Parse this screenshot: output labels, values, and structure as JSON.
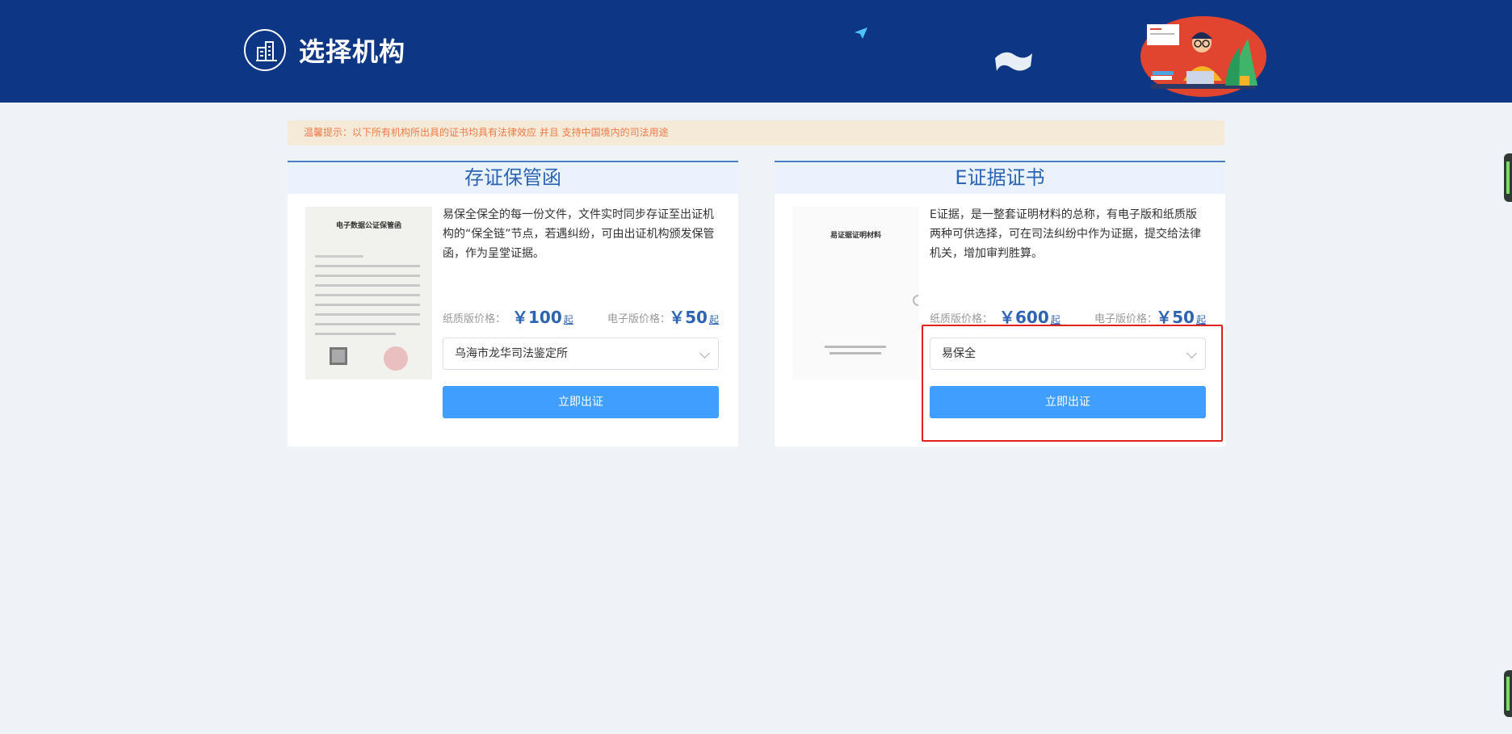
{
  "header": {
    "title": "选择机构",
    "logo_icon": "building-icon",
    "bg_color": "#0d3784"
  },
  "notice": {
    "text": "温馨提示：以下所有机构所出具的证书均具有法律效应 并且 支持中国境内的司法用途"
  },
  "cards": [
    {
      "title": "存证保管函",
      "doc_title": "电子数据公证保管函",
      "description": "易保全保全的每一份文件，文件实时同步存证至出证机构的“保全链”节点，若遇纠纷，可由出证机构颁发保管函，作为呈堂证据。",
      "paper_price_label": "纸质版价格：",
      "paper_price": "￥100",
      "paper_price_suffix": "起",
      "e_price_label": "电子版价格：",
      "e_price": "￥50",
      "e_price_suffix": "起",
      "select_value": "乌海市龙华司法鉴定所",
      "button_label": "立即出证"
    },
    {
      "title": "E证据证书",
      "doc_title": "易证据证明材料",
      "description": "E证据，是一整套证明材料的总称，有电子版和纸质版两种可供选择，可在司法纠纷中作为证据，提交给法律机关，增加审判胜算。",
      "paper_price_label": "纸质版价格：",
      "paper_price": "￥600",
      "paper_price_suffix": "起",
      "e_price_label": "电子版价格：",
      "e_price": "￥50",
      "e_price_suffix": "起",
      "select_value": "易保全",
      "button_label": "立即出证"
    }
  ],
  "colors": {
    "accent": "#409eff",
    "title_blue": "#2d63b3",
    "notice_text": "#f07a48",
    "notice_bg": "#f5ead7",
    "highlight": "#e0211a"
  }
}
